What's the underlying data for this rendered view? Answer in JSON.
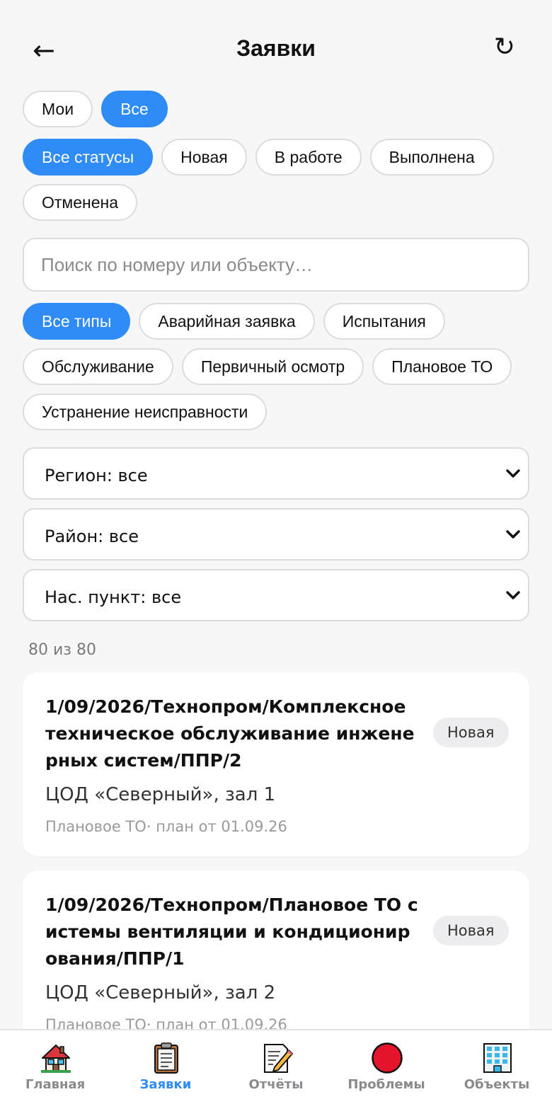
{
  "header": {
    "back_label": "←",
    "title": "Заявки",
    "refresh_label": "↻"
  },
  "scope_filters": [
    {
      "label": "Мои",
      "active": false
    },
    {
      "label": "Все",
      "active": true
    }
  ],
  "status_filters": [
    {
      "label": "Все статусы",
      "active": true
    },
    {
      "label": "Новая",
      "active": false
    },
    {
      "label": "В работе",
      "active": false
    },
    {
      "label": "Выполнена",
      "active": false
    },
    {
      "label": "Отменена",
      "active": false
    }
  ],
  "search": {
    "placeholder": "Поиск по номеру или объекту…",
    "value": ""
  },
  "type_filters": [
    {
      "label": "Все типы",
      "active": true
    },
    {
      "label": "Аварийная заявка",
      "active": false
    },
    {
      "label": "Испытания",
      "active": false
    },
    {
      "label": "Обслуживание",
      "active": false
    },
    {
      "label": "Первичный осмотр",
      "active": false
    },
    {
      "label": "Плановое ТО",
      "active": false
    },
    {
      "label": "Устранение неисправности",
      "active": false
    }
  ],
  "selects": {
    "region": "Регион: все",
    "district": "Район: все",
    "town": "Нас. пункт: все"
  },
  "count_text": "80 из 80",
  "requests": [
    {
      "title": "1/09/2026/Технопром/Комплексное техническое обслуживание инженерных систем/ППР/2",
      "status": "Новая",
      "object": "ЦОД «Северный», зал 1",
      "meta": "Плановое ТО· план от 01.09.26"
    },
    {
      "title": "1/09/2026/Технопром/Плановое ТО системы вентиляции и кондиционирования/ППР/1",
      "status": "Новая",
      "object": "ЦОД «Северный», зал 2",
      "meta": "Плановое ТО· план от 01.09.26"
    }
  ],
  "tabbar": [
    {
      "label": "Главная",
      "icon": "house-icon",
      "active": false
    },
    {
      "label": "Заявки",
      "icon": "clipboard-icon",
      "active": true
    },
    {
      "label": "Отчёты",
      "icon": "memo-icon",
      "active": false
    },
    {
      "label": "Проблемы",
      "icon": "red-circle-icon",
      "active": false
    },
    {
      "label": "Объекты",
      "icon": "building-icon",
      "active": false
    }
  ],
  "colors": {
    "accent": "#2f8cf6",
    "background": "#f7f7f8",
    "badge_bg": "#ededef"
  }
}
